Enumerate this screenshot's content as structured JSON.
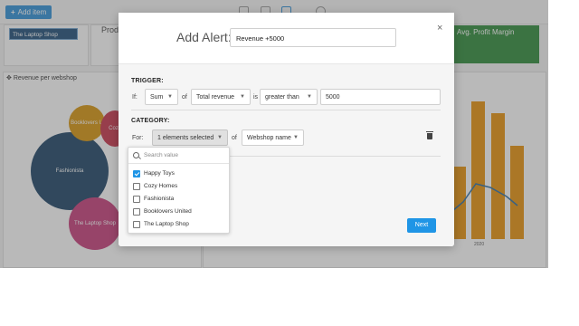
{
  "toolbar": {
    "add_item_label": "Add item"
  },
  "dashboard": {
    "shop_chip": "The Laptop Shop",
    "product_label": "Prod",
    "kpi_label": "Avg. Profit Margin",
    "widget_title": "Revenue per webshop",
    "bubbles": [
      "Booklovers U",
      "Cozy",
      "Fashionista",
      "The Laptop Shop"
    ],
    "axis_year": "2020"
  },
  "modal": {
    "title": "Add Alert:",
    "alert_name": "Revenue +5000",
    "trigger": {
      "heading": "TRIGGER:",
      "if_label": "If:",
      "aggregation": "Sum",
      "of_label": "of",
      "metric": "Total revenue",
      "is_label": "is",
      "comparator": "greater than",
      "value": "5000"
    },
    "category": {
      "heading": "CATEGORY:",
      "for_label": "For:",
      "selection": "1 elements selected",
      "of_label": "of",
      "dimension": "Webshop name"
    },
    "next_label": "Next",
    "close_glyph": "×"
  },
  "dropdown": {
    "search_placeholder": "Search value",
    "options": [
      {
        "label": "Happy Toys",
        "checked": true
      },
      {
        "label": "Cozy Homes",
        "checked": false
      },
      {
        "label": "Fashionista",
        "checked": false
      },
      {
        "label": "Booklovers United",
        "checked": false
      },
      {
        "label": "The Laptop Shop",
        "checked": false
      }
    ]
  },
  "colors": {
    "accent": "#1f95e6",
    "kpi_green": "#2e8b3a",
    "bar_orange": "#e8920a",
    "bubble_navy": "#1d4466",
    "bubble_magenta": "#c63c7a",
    "bubble_gold": "#d8950c"
  }
}
